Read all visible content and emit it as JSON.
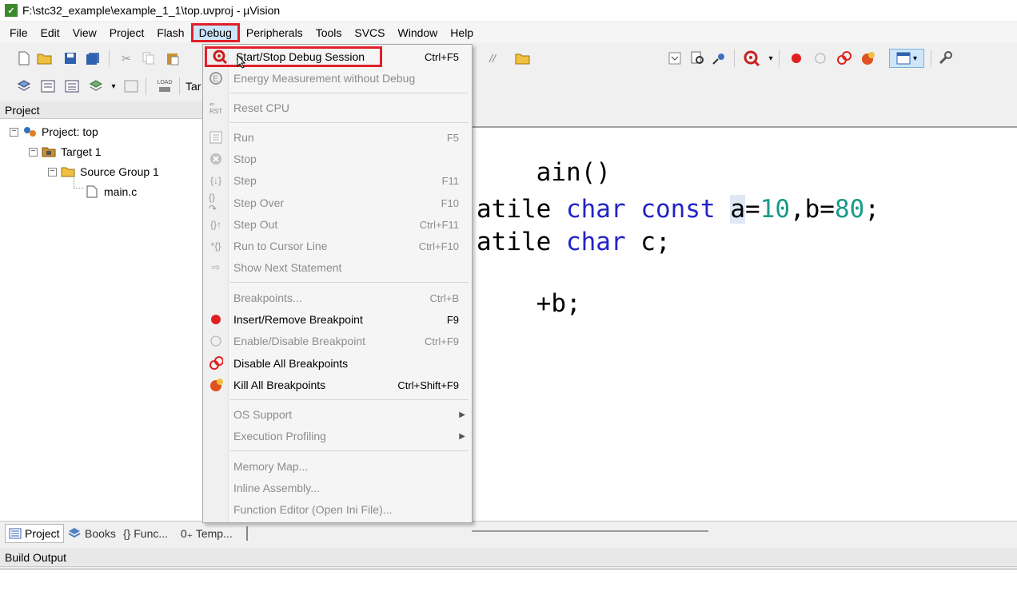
{
  "window": {
    "title": "F:\\stc32_example\\example_1_1\\top.uvproj - µVision"
  },
  "menubar": [
    "File",
    "Edit",
    "View",
    "Project",
    "Flash",
    "Debug",
    "Peripherals",
    "Tools",
    "SVCS",
    "Window",
    "Help"
  ],
  "toolbar": {
    "load_label": "LOAD",
    "target_prefix": "Tar"
  },
  "project_panel": {
    "title": "Project",
    "tree": {
      "root": "Project: top",
      "target": "Target 1",
      "group": "Source Group 1",
      "file": "main.c"
    }
  },
  "editor": {
    "line1": "ain()",
    "line2_a": "atile ",
    "line2_kw1": "char",
    "line2_kw2": "const",
    "line2_var": "a",
    "line2_eq": "=",
    "line2_num1": "10",
    "line2_mid": ",b=",
    "line2_num2": "80",
    "line2_end": ";",
    "line3_a": "atile ",
    "line3_kw": "char",
    "line3_rest": " c;",
    "line4": "+b;"
  },
  "bottom_tabs": [
    "Project",
    "Books",
    "{} Func...",
    "0₊ Temp..."
  ],
  "build_output": {
    "title": "Build Output"
  },
  "debug_menu": {
    "items": [
      {
        "label": "Start/Stop Debug Session",
        "shortcut": "Ctrl+F5",
        "enabled": true
      },
      {
        "label": "Energy Measurement without Debug",
        "shortcut": "",
        "enabled": false
      },
      {
        "label": "Reset CPU",
        "shortcut": "",
        "enabled": false
      },
      {
        "label": "Run",
        "shortcut": "F5",
        "enabled": false
      },
      {
        "label": "Stop",
        "shortcut": "",
        "enabled": false
      },
      {
        "label": "Step",
        "shortcut": "F11",
        "enabled": false
      },
      {
        "label": "Step Over",
        "shortcut": "F10",
        "enabled": false
      },
      {
        "label": "Step Out",
        "shortcut": "Ctrl+F11",
        "enabled": false
      },
      {
        "label": "Run to Cursor Line",
        "shortcut": "Ctrl+F10",
        "enabled": false
      },
      {
        "label": "Show Next Statement",
        "shortcut": "",
        "enabled": false
      },
      {
        "label": "Breakpoints...",
        "shortcut": "Ctrl+B",
        "enabled": false
      },
      {
        "label": "Insert/Remove Breakpoint",
        "shortcut": "F9",
        "enabled": true
      },
      {
        "label": "Enable/Disable Breakpoint",
        "shortcut": "Ctrl+F9",
        "enabled": false
      },
      {
        "label": "Disable All Breakpoints",
        "shortcut": "",
        "enabled": true
      },
      {
        "label": "Kill All Breakpoints",
        "shortcut": "Ctrl+Shift+F9",
        "enabled": true
      },
      {
        "label": "OS Support",
        "shortcut": "",
        "enabled": false
      },
      {
        "label": "Execution Profiling",
        "shortcut": "",
        "enabled": false
      },
      {
        "label": "Memory Map...",
        "shortcut": "",
        "enabled": false
      },
      {
        "label": "Inline Assembly...",
        "shortcut": "",
        "enabled": false
      },
      {
        "label": "Function Editor (Open Ini File)...",
        "shortcut": "",
        "enabled": false
      }
    ]
  },
  "colors": {
    "highlight_border": "#e0202a",
    "keyword": "#2323c8",
    "number": "#1a9a8a"
  }
}
